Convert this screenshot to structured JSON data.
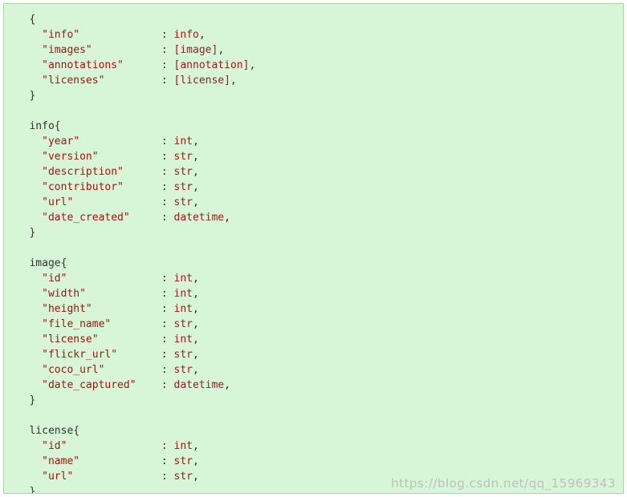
{
  "watermark": "https://blog.csdn.net/qq_15969343",
  "blocks": [
    {
      "header": null,
      "fields": [
        {
          "key": "\"info\"",
          "value": "info"
        },
        {
          "key": "\"images\"",
          "value": "[image]"
        },
        {
          "key": "\"annotations\"",
          "value": "[annotation]"
        },
        {
          "key": "\"licenses\"",
          "value": "[license]"
        }
      ]
    },
    {
      "header": "info",
      "fields": [
        {
          "key": "\"year\"",
          "value": "int"
        },
        {
          "key": "\"version\"",
          "value": "str"
        },
        {
          "key": "\"description\"",
          "value": "str"
        },
        {
          "key": "\"contributor\"",
          "value": "str"
        },
        {
          "key": "\"url\"",
          "value": "str"
        },
        {
          "key": "\"date_created\"",
          "value": "datetime"
        }
      ]
    },
    {
      "header": "image",
      "fields": [
        {
          "key": "\"id\"",
          "value": "int"
        },
        {
          "key": "\"width\"",
          "value": "int"
        },
        {
          "key": "\"height\"",
          "value": "int"
        },
        {
          "key": "\"file_name\"",
          "value": "str"
        },
        {
          "key": "\"license\"",
          "value": "int"
        },
        {
          "key": "\"flickr_url\"",
          "value": "str"
        },
        {
          "key": "\"coco_url\"",
          "value": "str"
        },
        {
          "key": "\"date_captured\"",
          "value": "datetime"
        }
      ]
    },
    {
      "header": "license",
      "fields": [
        {
          "key": "\"id\"",
          "value": "int"
        },
        {
          "key": "\"name\"",
          "value": "str"
        },
        {
          "key": "\"url\"",
          "value": "str"
        }
      ]
    }
  ],
  "layout": {
    "indent1": "   ",
    "indent2": "     ",
    "colon_col": 24
  }
}
